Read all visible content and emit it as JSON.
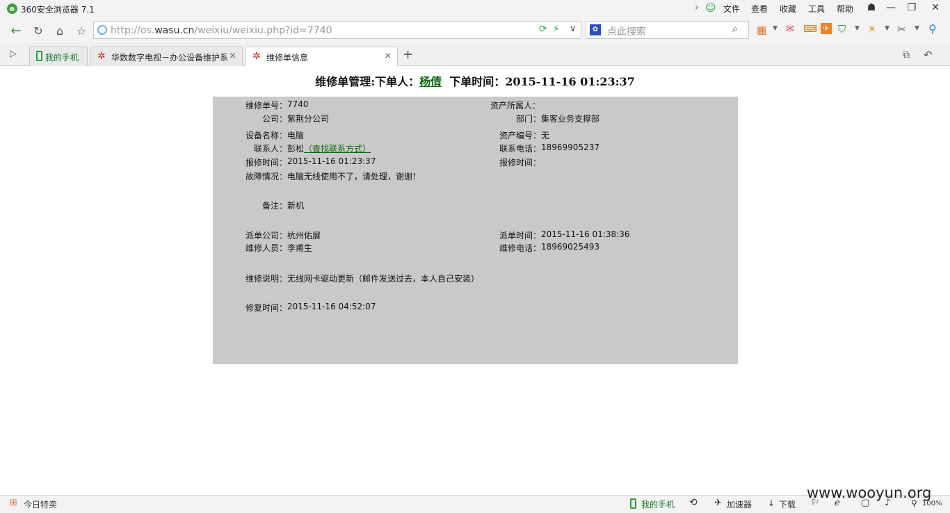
{
  "window": {
    "title": "360安全浏览器 7.1",
    "menu": [
      "文件",
      "查看",
      "收藏",
      "工具",
      "帮助"
    ]
  },
  "address": {
    "url_prefix": "http://os.",
    "url_domain": "wasu.cn",
    "url_path": "/weixiu/weixiu.php?id=7740",
    "search_placeholder": "点此搜索"
  },
  "tabs": [
    {
      "label": "我的手机",
      "active": false
    },
    {
      "label": "华数数字电视－办公设备维护系",
      "active": false
    },
    {
      "label": "维修单信息",
      "active": true
    }
  ],
  "page": {
    "heading_prefix": "维修单管理:下单人：",
    "heading_name": "杨倩",
    "heading_suffix": "下单时间：2015-11-16 01:23:37",
    "fields": {
      "order_no_label": "维修单号：",
      "order_no": "7740",
      "asset_owner_label": "资产所属人：",
      "asset_owner": "",
      "company_label": "公司：",
      "company": "紫荆分公司",
      "dept_label": "部门：",
      "dept": "集客业务支撑部",
      "device_label": "设备名称：",
      "device": "电脑",
      "asset_no_label": "资产编号：",
      "asset_no": "无",
      "contact_label": "联系人：",
      "contact": "彭松",
      "contact_link": "（查找联系方式）",
      "phone_label": "联系电话：",
      "phone": "18969905237",
      "report_time_label": "报修时间：",
      "report_time": "2015-11-16 01:23:37",
      "report_time2_label": "报修时间：",
      "report_time2": "",
      "fault_label": "故障情况：",
      "fault": "电脑无线使用不了，请处理，谢谢！",
      "remark_label": "备注：",
      "remark": "新机",
      "dispatch_company_label": "派单公司：",
      "dispatch_company": "杭州佑展",
      "dispatch_time_label": "派单时间：",
      "dispatch_time": "2015-11-16 01:38:36",
      "repairer_label": "维修人员：",
      "repairer": "李甫生",
      "repair_phone_label": "维修电话：",
      "repair_phone": "18969025493",
      "repair_note_label": "维修说明：",
      "repair_note": "无线网卡驱动更新（邮件发送过去，本人自己安装）",
      "fix_time_label": "修复时间：",
      "fix_time": "2015-11-16 04:52:07"
    }
  },
  "statusbar": {
    "left": "今日特卖",
    "phone": "我的手机",
    "accelerator": "加速器",
    "download": "下载",
    "zoom": "100%",
    "watermark": "www.wooyun.org"
  },
  "colors": {
    "accent": "#0a6b0a",
    "panel_bg": "#c9c9c9"
  }
}
